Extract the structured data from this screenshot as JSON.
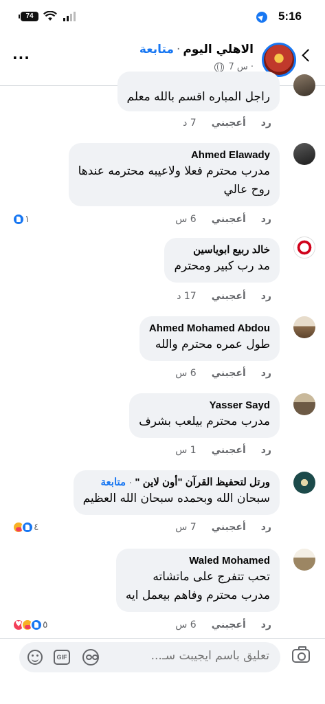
{
  "status_bar": {
    "time": "5:16",
    "battery": "74"
  },
  "header": {
    "page_name": "الاهلي اليوم",
    "follow_label": "متابعة",
    "separator": "·",
    "post_time": "7 س ·"
  },
  "comments": [
    {
      "name": "",
      "text_lines": [
        "راجل المباره اقسم بالله معلم"
      ],
      "time": "7 د",
      "like_label": "أعجبني",
      "reply_label": "رد",
      "reaction_count": ""
    },
    {
      "name": "Ahmed Elawady",
      "text_lines": [
        "مدرب محترم فعلا ولاعيبه محترمه عندها",
        "روح عالي"
      ],
      "time": "6 س",
      "like_label": "أعجبني",
      "reply_label": "رد",
      "reaction_count": "١"
    },
    {
      "name": "خالد ربيع ابوياسين",
      "text_lines": [
        "مد رب كبير ومحترم"
      ],
      "time": "17 د",
      "like_label": "أعجبني",
      "reply_label": "رد",
      "reaction_count": ""
    },
    {
      "name": "Ahmed Mohamed Abdou",
      "text_lines": [
        "طول عمره محترم والله"
      ],
      "time": "6 س",
      "like_label": "أعجبني",
      "reply_label": "رد",
      "reaction_count": ""
    },
    {
      "name": "Yasser Sayd",
      "text_lines": [
        "مدرب محترم بيلعب بشرف"
      ],
      "time": "1 س",
      "like_label": "أعجبني",
      "reply_label": "رد",
      "reaction_count": ""
    },
    {
      "name": "ورتل لتحفيظ القرآن \"أون لاين \"",
      "follow_label": "متابعة",
      "separator": "·",
      "text_lines": [
        "سبحان الله وبحمده سبحان الله العظيم"
      ],
      "time": "7 س",
      "like_label": "أعجبني",
      "reply_label": "رد",
      "reaction_count": "٤"
    },
    {
      "name": "Waled Mohamed",
      "text_lines": [
        "تحب تتفرج على ماتشاته",
        "مدرب محترم وفاهم بيعمل ايه"
      ],
      "time": "6 س",
      "like_label": "أعجبني",
      "reply_label": "رد",
      "reaction_count": "٥"
    }
  ],
  "composer": {
    "placeholder": "تعليق باسم ايجيبت سـ...",
    "gif_label": "GIF"
  },
  "colors": {
    "accent": "#1877f2",
    "bubble": "#f0f2f5",
    "muted": "#65676b"
  }
}
